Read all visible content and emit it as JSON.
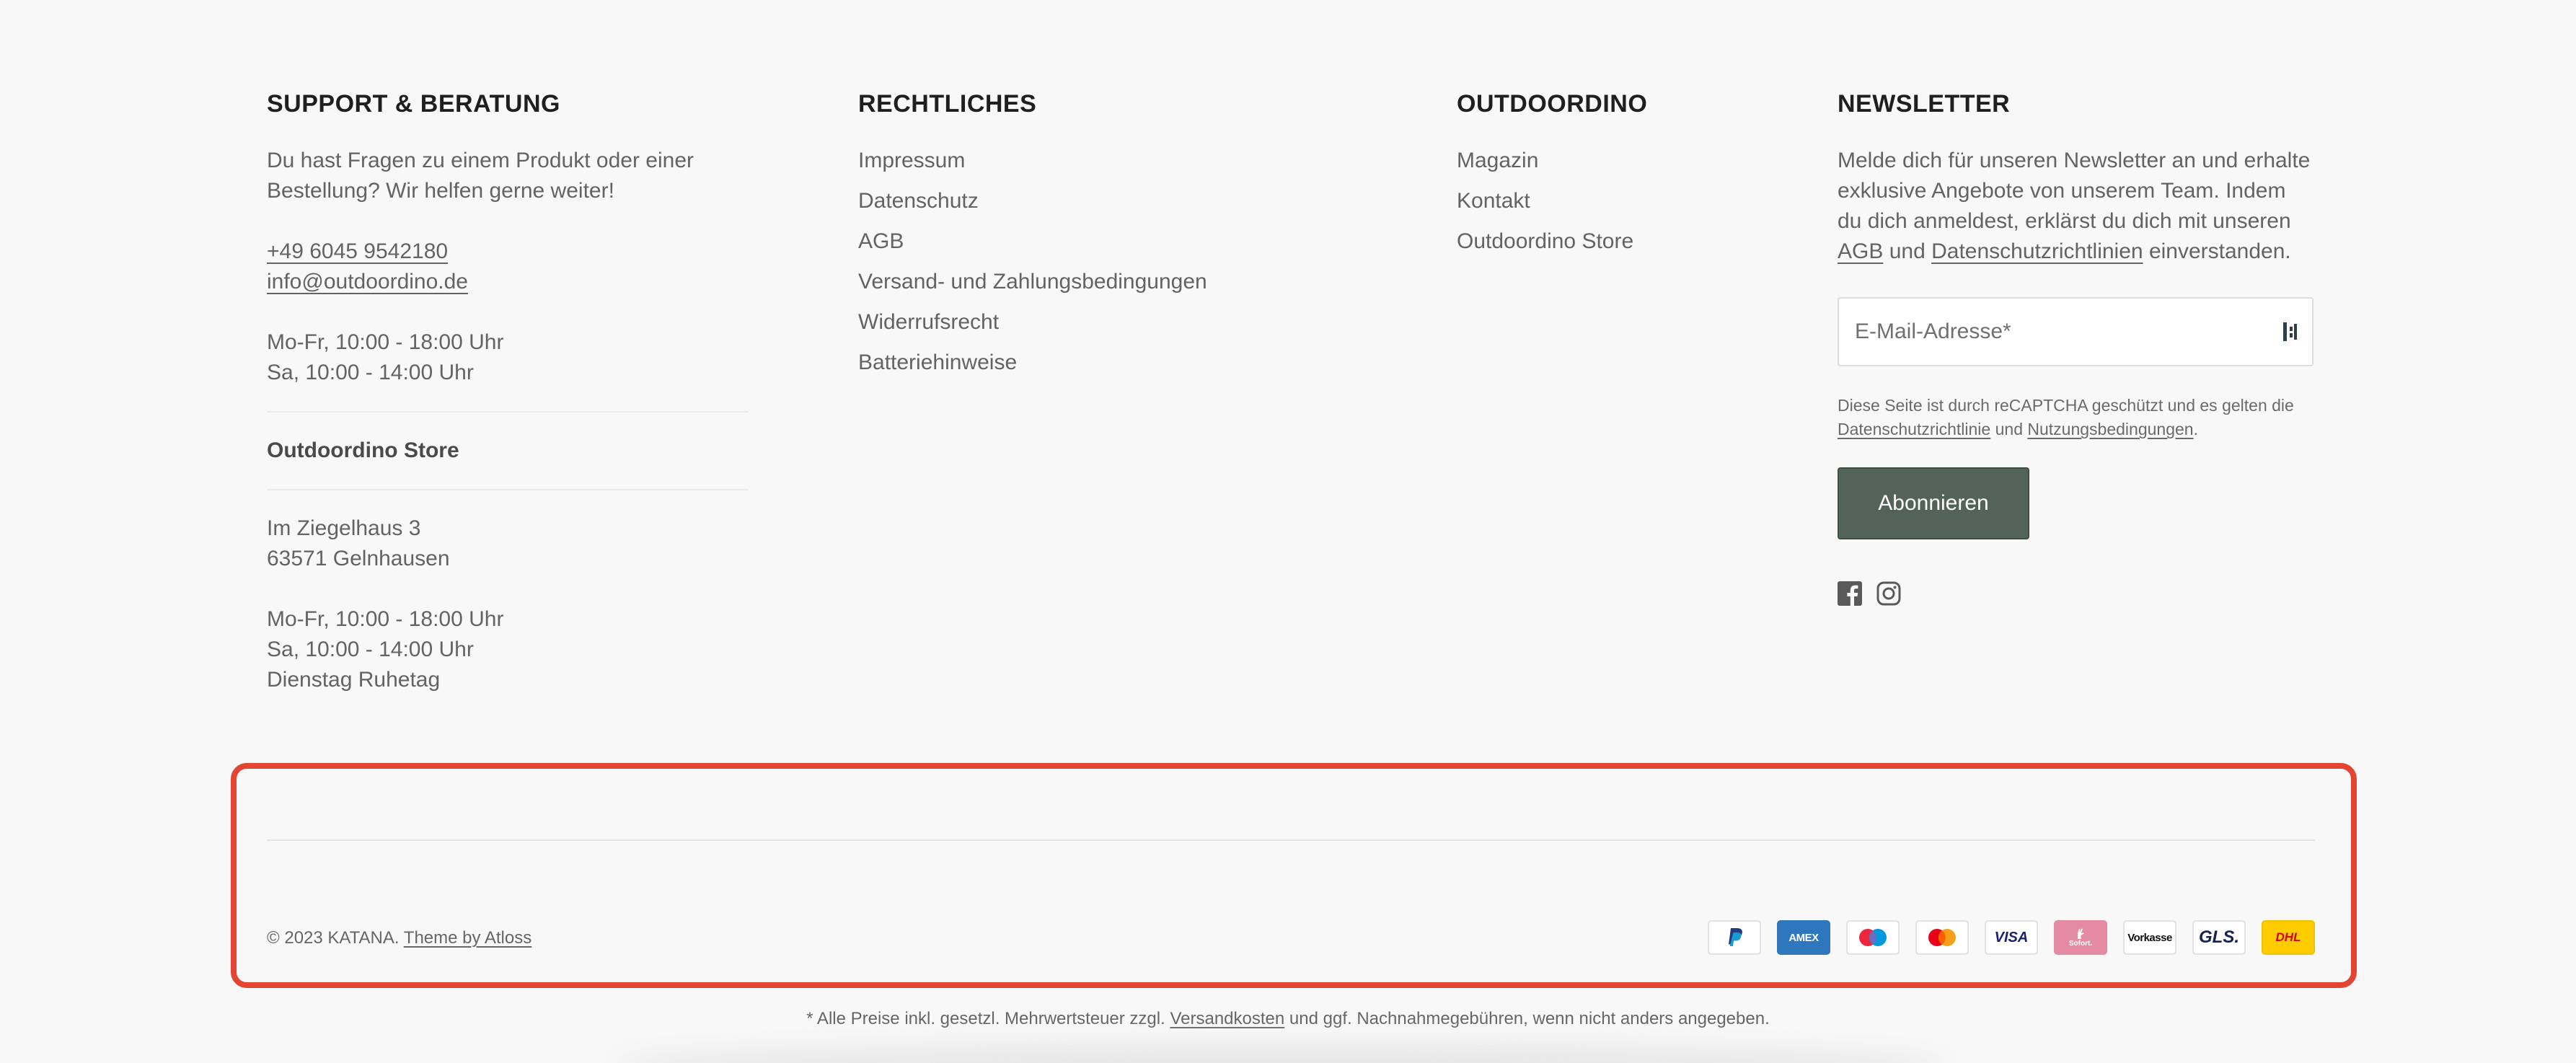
{
  "support": {
    "heading": "SUPPORT & BERATUNG",
    "intro": "Du hast Fragen zu einem Produkt oder einer Bestellung? Wir helfen gerne weiter!",
    "phone": "+49 6045 9542180",
    "email": "info@outdoordino.de",
    "hours_weekday": "Mo-Fr, 10:00 - 18:00 Uhr",
    "hours_saturday": "Sa, 10:00 - 14:00 Uhr",
    "store_title": "Outdoordino Store",
    "street": "Im Ziegelhaus 3",
    "city": "63571 Gelnhausen",
    "store_hours_weekday": "Mo-Fr, 10:00 - 18:00 Uhr",
    "store_hours_saturday": "Sa, 10:00 - 14:00 Uhr",
    "store_closed": "Dienstag Ruhetag"
  },
  "legal": {
    "heading": "RECHTLICHES",
    "links": [
      "Impressum",
      "Datenschutz",
      "AGB",
      "Versand- und Zahlungsbedingungen",
      "Widerrufsrecht",
      "Batteriehinweise"
    ]
  },
  "outdoordino": {
    "heading": "OUTDOORDINO",
    "links": [
      "Magazin",
      "Kontakt",
      "Outdoordino Store"
    ]
  },
  "newsletter": {
    "heading": "NEWSLETTER",
    "text_before_agb": "Melde dich für unseren Newsletter an und erhalte exklusive Angebote von unserem Team. Indem du dich anmeldest, erklärst du dich mit unseren",
    "agb_link": "AGB",
    "text_und": "und",
    "privacy_link": "Datenschutzrichtlinien",
    "text_after": "einverstanden.",
    "email_placeholder": "E-Mail-Adresse*",
    "recaptcha_text": "Diese Seite ist durch reCAPTCHA geschützt und es gelten die",
    "recaptcha_privacy": "Datenschutzrichtlinie",
    "recaptcha_und": "und",
    "recaptcha_terms": "Nutzungsbedingungen",
    "recaptcha_end": ".",
    "subscribe_label": "Abonnieren",
    "social_icons": [
      "facebook-icon",
      "instagram-icon"
    ]
  },
  "bottom": {
    "copyright_text": "© 2023 KATANA.",
    "theme_link": "Theme by Atloss",
    "payment_icons": [
      "paypal-icon",
      "amex-icon",
      "maestro-icon",
      "mastercard-icon",
      "visa-icon",
      "sofort-icon",
      "vorkasse-icon",
      "gls-icon",
      "dhl-icon"
    ],
    "payment_labels": {
      "amex": "AMEX",
      "visa": "VISA",
      "sofort": "Sofort.",
      "vorkasse": "Vorkasse",
      "gls": "GLS.",
      "dhl": "DHL"
    }
  },
  "footnote": {
    "text_before": "* Alle Preise inkl. gesetzl. Mehrwertsteuer zzgl.",
    "shipping_link": "Versandkosten",
    "text_after": "und ggf. Nachnahmegebühren, wenn nicht anders angegeben."
  },
  "colors": {
    "background": "#f8f8f8",
    "button": "#536359",
    "highlight": "#e34532",
    "heading": "#1f1f1f",
    "text": "#636363"
  }
}
